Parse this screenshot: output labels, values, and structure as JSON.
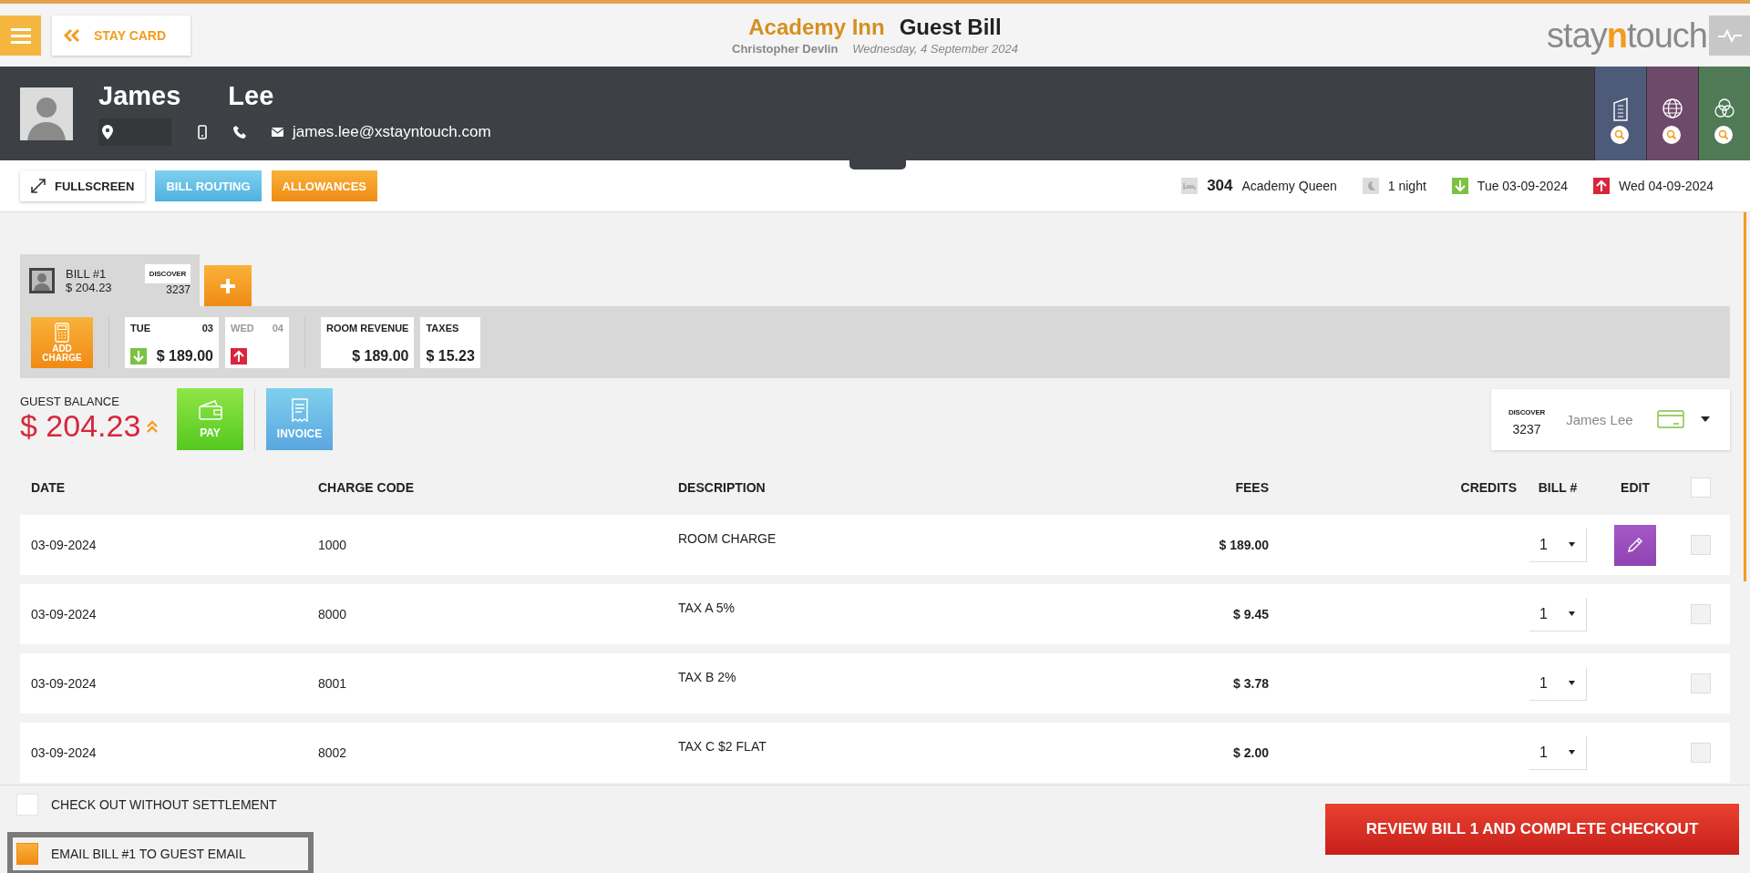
{
  "header": {
    "back_button": "STAY CARD",
    "hotel": "Academy Inn",
    "title": "Guest Bill",
    "user": "Christopher Devlin",
    "date": "Wednesday, 4 September 2024",
    "logo": [
      {
        "text": "stay",
        "accent": false
      },
      {
        "text": "n",
        "accent": true
      },
      {
        "text": "touch",
        "accent": false
      }
    ]
  },
  "guest": {
    "first_name": "James",
    "last_name": "Lee",
    "email": "james.lee@xstayntouch.com",
    "side_tabs": [
      {
        "kind": "building",
        "color": "#4e5a7a"
      },
      {
        "kind": "globe",
        "color": "#6e4a6a"
      },
      {
        "kind": "circles",
        "color": "#4f7a55"
      }
    ]
  },
  "toolbar": {
    "buttons": [
      {
        "label": "FULLSCREEN",
        "kind": "plain"
      },
      {
        "label": "BILL ROUTING",
        "kind": "blue"
      },
      {
        "label": "ALLOWANCES",
        "kind": "orange"
      }
    ],
    "room": "304",
    "room_type": "Academy Queen",
    "nights": "1 night",
    "arrival": "Tue 03-09-2024",
    "departure": "Wed 04-09-2024"
  },
  "bills": [
    {
      "label": "BILL #1",
      "amount": "$ 204.23",
      "card": "DISCOVER",
      "card_number": "3237",
      "selected": true
    }
  ],
  "add_charge": "ADD CHARGE",
  "days": [
    {
      "day": "TUE",
      "date": "03",
      "kind": "arrival",
      "amount": "$ 189.00",
      "selected": true
    },
    {
      "day": "WED",
      "date": "04",
      "kind": "departure",
      "selected": false
    }
  ],
  "summary": [
    {
      "label": "ROOM REVENUE",
      "amount": "$ 189.00"
    },
    {
      "label": "TAXES",
      "amount": "$ 15.23"
    }
  ],
  "balance": {
    "label": "GUEST BALANCE",
    "amount": "$ 204.23",
    "pay": "PAY",
    "invoice": "INVOICE"
  },
  "payment_card": {
    "brand": "DISCOVER",
    "number": "3237",
    "name": "James Lee"
  },
  "table": {
    "columns": [
      "DATE",
      "CHARGE CODE",
      "DESCRIPTION",
      "FEES",
      "CREDITS",
      "BILL #",
      "EDIT"
    ],
    "all_checked": false,
    "rows": [
      {
        "date": "03-09-2024",
        "code": "1000",
        "description": "ROOM CHARGE",
        "fees": "$ 189.00",
        "bill": "1",
        "editable": true,
        "checked": false
      },
      {
        "date": "03-09-2024",
        "code": "8000",
        "description": "TAX A 5%",
        "fees": "$ 9.45",
        "bill": "1",
        "editable": false,
        "checked": false
      },
      {
        "date": "03-09-2024",
        "code": "8001",
        "description": "TAX B 2%",
        "fees": "$ 3.78",
        "bill": "1",
        "editable": false,
        "checked": false
      },
      {
        "date": "03-09-2024",
        "code": "8002",
        "description": "TAX C $2 FLAT",
        "fees": "$ 2.00",
        "bill": "1",
        "editable": false,
        "checked": false
      }
    ]
  },
  "footer": {
    "options": [
      {
        "label": "CHECK OUT WITHOUT SETTLEMENT",
        "checked": false,
        "focused": false
      },
      {
        "label": "EMAIL BILL #1 TO GUEST EMAIL",
        "checked": true,
        "focused": true
      }
    ],
    "review_button": "REVIEW BILL 1 AND COMPLETE CHECKOUT"
  }
}
